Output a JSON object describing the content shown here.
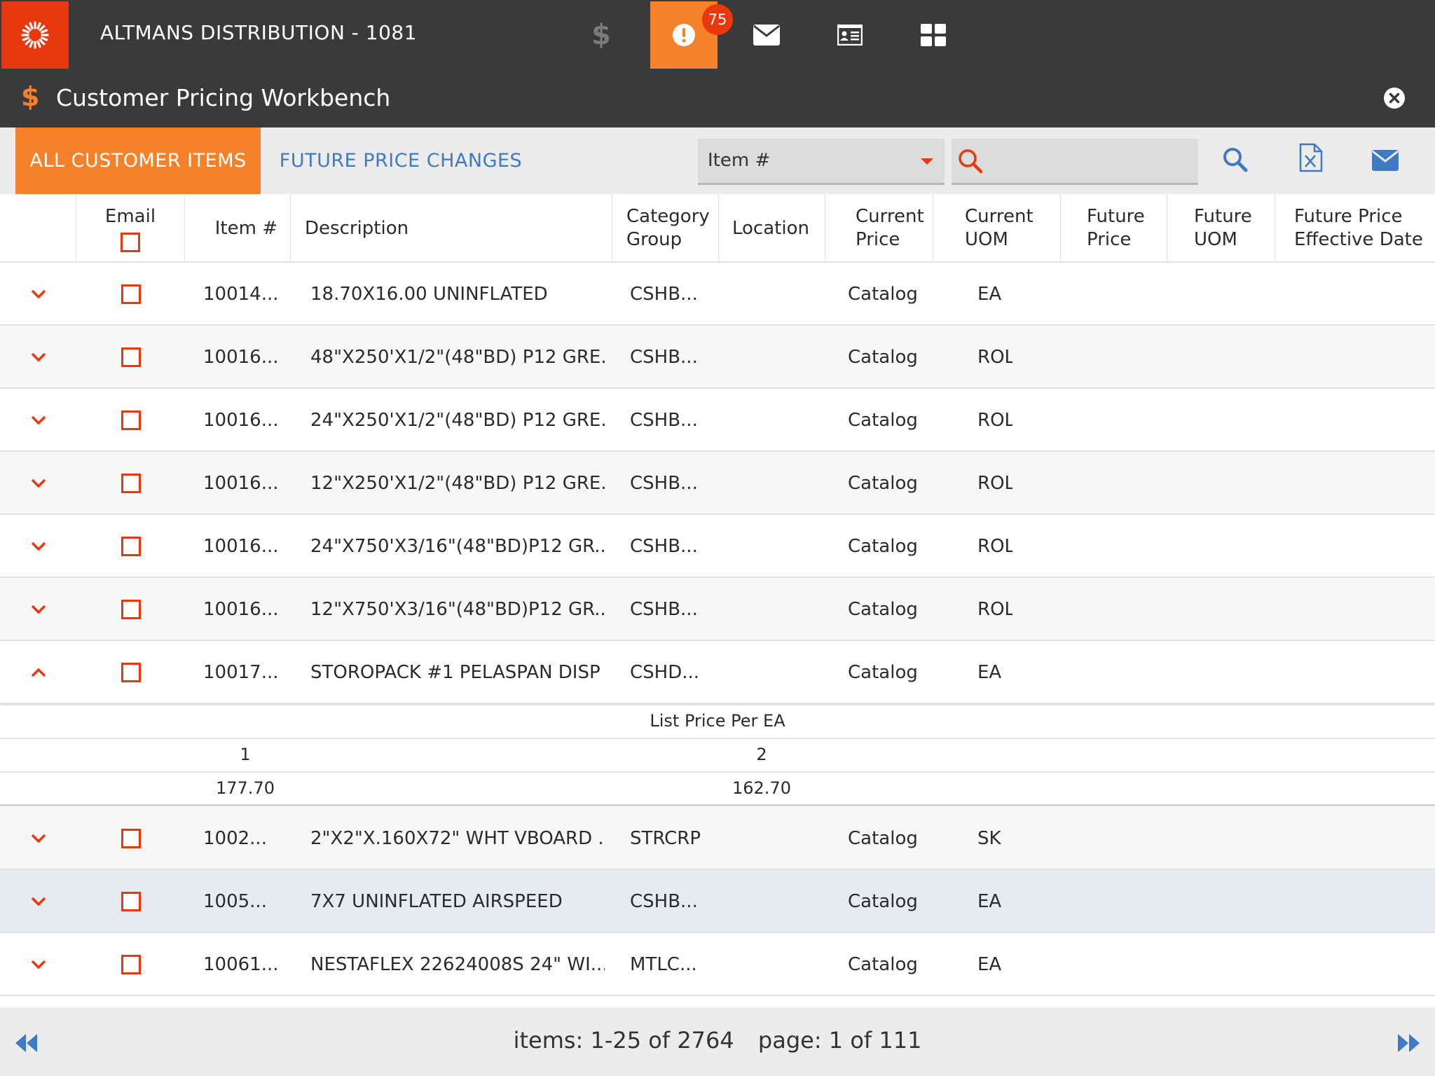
{
  "app": {
    "company": "ALTMANS DISTRIBUTION - 1081",
    "alerts_count": "75",
    "dollar_symbol": "$"
  },
  "page": {
    "title": "Customer Pricing Workbench"
  },
  "tabs": [
    {
      "label": "ALL CUSTOMER ITEMS",
      "active": true
    },
    {
      "label": "FUTURE PRICE CHANGES",
      "active": false
    }
  ],
  "filter": {
    "selected": "Item #"
  },
  "search": {
    "value": ""
  },
  "columns": {
    "email": "Email",
    "item": "Item #",
    "description": "Description",
    "category_line1": "Category",
    "category_line2": "Group",
    "location": "Location",
    "current_price_line1": "Current",
    "current_price_line2": "Price",
    "current_uom_line1": "Current",
    "current_uom_line2": "UOM",
    "future_price_line1": "Future",
    "future_price_line2": "Price",
    "future_uom_line1": "Future",
    "future_uom_line2": "UOM",
    "future_date_line1": "Future Price",
    "future_date_line2": "Effective Date"
  },
  "rows": [
    {
      "item": "10014...",
      "description": "18.70X16.00 UNINFLATED",
      "category": "CSHB...",
      "current_price": "Catalog",
      "current_uom": "EA"
    },
    {
      "item": "10016...",
      "description": "48\"X250'X1/2\"(48\"BD) P12 GRE...",
      "category": "CSHB...",
      "current_price": "Catalog",
      "current_uom": "ROL"
    },
    {
      "item": "10016...",
      "description": "24\"X250'X1/2\"(48\"BD) P12 GRE...",
      "category": "CSHB...",
      "current_price": "Catalog",
      "current_uom": "ROL"
    },
    {
      "item": "10016...",
      "description": "12\"X250'X1/2\"(48\"BD) P12 GRE...",
      "category": "CSHB...",
      "current_price": "Catalog",
      "current_uom": "ROL"
    },
    {
      "item": "10016...",
      "description": "24\"X750'X3/16\"(48\"BD)P12 GR...",
      "category": "CSHB...",
      "current_price": "Catalog",
      "current_uom": "ROL"
    },
    {
      "item": "10016...",
      "description": "12\"X750'X3/16\"(48\"BD)P12 GR...",
      "category": "CSHB...",
      "current_price": "Catalog",
      "current_uom": "ROL"
    },
    {
      "item": "10017...",
      "description": "STOROPACK #1 PELASPAN DISP",
      "category": "CSHD...",
      "current_price": "Catalog",
      "current_uom": "EA"
    },
    {
      "item": "1002...",
      "description": "2\"X2\"X.160X72\" WHT VBOARD ...",
      "category": "STRCRP",
      "current_price": "Catalog",
      "current_uom": "SK"
    },
    {
      "item": "1005...",
      "description": "7X7 UNINFLATED AIRSPEED",
      "category": "CSHB...",
      "current_price": "Catalog",
      "current_uom": "EA"
    },
    {
      "item": "10061...",
      "description": "NESTAFLEX 22624008S 24\" WI...",
      "category": "MTLC...",
      "current_price": "Catalog",
      "current_uom": "EA"
    }
  ],
  "detail": {
    "header": "List Price Per EA",
    "qty_1": "1",
    "qty_2": "2",
    "price_1": "177.70",
    "price_2": "162.70"
  },
  "pagination": {
    "items": "items: 1-25 of 2764",
    "page": "page: 1 of 111"
  },
  "colors": {
    "accent_orange": "#f5822a",
    "logo_red": "#e8380d",
    "nav_dark": "#3a3a3a",
    "link_blue": "#3f7bc4",
    "selected_row": "#e6eaf1"
  },
  "icons": [
    "logo-icon",
    "dollar-icon",
    "alert-icon",
    "mail-icon",
    "contact-card-icon",
    "dashboard-icon",
    "close-icon",
    "chevron-down-icon",
    "chevron-up-icon",
    "search-icon",
    "excel-icon",
    "first-page-icon",
    "last-page-icon"
  ]
}
